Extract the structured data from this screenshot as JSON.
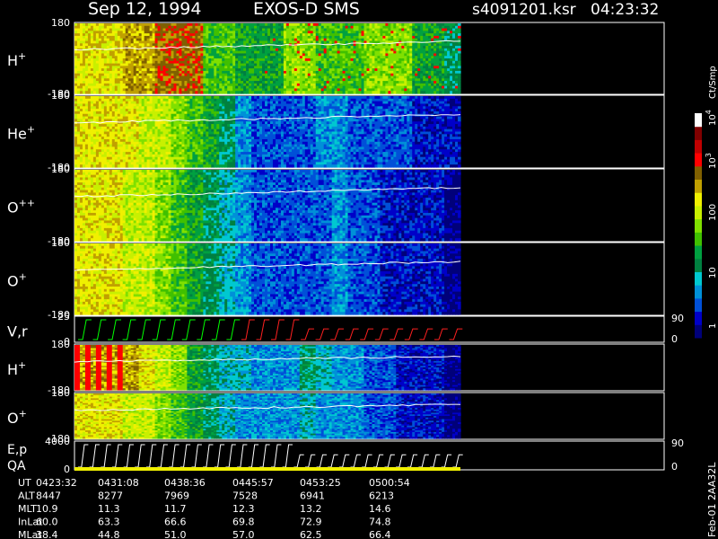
{
  "header": {
    "date": "Sep 12, 1994",
    "instrument": "EXOS-D SMS",
    "file": "s4091201.ksr",
    "time": "04:23:32"
  },
  "colorbar": {
    "unit": "Ct/Smp",
    "ticks": [
      "1",
      "10",
      "100",
      "10",
      "10"
    ],
    "tick_exponents": [
      "",
      "",
      "",
      "3",
      "4"
    ],
    "colors": [
      "#00007a",
      "#0000c8",
      "#0050d8",
      "#0090d8",
      "#00c8d0",
      "#008040",
      "#00a040",
      "#40c000",
      "#80e000",
      "#c8f000",
      "#f0f000",
      "#c0a000",
      "#806000",
      "#ff0000",
      "#c00000",
      "#800000",
      "#ffffff"
    ]
  },
  "panels": [
    {
      "label": "H",
      "sup": "+",
      "ymax": "180",
      "ymin": "-180"
    },
    {
      "label": "He",
      "sup": "+",
      "ymax": "180",
      "ymin": "-180"
    },
    {
      "label": "O",
      "sup": "++",
      "ymax": "180",
      "ymin": "-180"
    },
    {
      "label": "O",
      "sup": "+",
      "ymax": "180",
      "ymin": "-180"
    },
    {
      "label": "V,r",
      "sup": "",
      "ymax": "25",
      "ymin": "0",
      "right_max": "90",
      "right_min": "0"
    },
    {
      "label": "H",
      "sup": "+",
      "ymax": "180",
      "ymin": "-180"
    },
    {
      "label": "O",
      "sup": "+",
      "ymax": "180",
      "ymin": "-180"
    },
    {
      "label": "E,p",
      "label2": "QA",
      "sup": "",
      "ymax": "4000",
      "ymin": "0",
      "right_max": "90",
      "right_min": "0"
    }
  ],
  "ephemeris": {
    "rows": [
      {
        "name": "UT",
        "values": [
          "0423:32",
          "0431:08",
          "0438:36",
          "0445:57",
          "0453:25",
          "0500:54"
        ]
      },
      {
        "name": "ALT",
        "values": [
          "8447",
          "8277",
          "7969",
          "7528",
          "6941",
          "6213"
        ]
      },
      {
        "name": "MLT",
        "values": [
          "10.9",
          "11.3",
          "11.7",
          "12.3",
          "13.2",
          "14.6"
        ]
      },
      {
        "name": "InLat",
        "values": [
          "60.0",
          "63.3",
          "66.6",
          "69.8",
          "72.9",
          "74.8"
        ]
      },
      {
        "name": "MLat",
        "values": [
          "38.4",
          "44.8",
          "51.0",
          "57.0",
          "62.5",
          "66.4"
        ]
      }
    ]
  },
  "footer": {
    "stamp": "Feb-01 2AA32L"
  },
  "chart_data": {
    "type": "heatmap",
    "x_ticks": [
      "0423:32",
      "0431:08",
      "0438:36",
      "0445:57",
      "0453:25",
      "0500:54"
    ],
    "color_scale": "log",
    "z_range": [
      1,
      10000
    ],
    "z_label": "Ct/Smp",
    "y_range_pitch": [
      -180,
      180
    ]
  }
}
